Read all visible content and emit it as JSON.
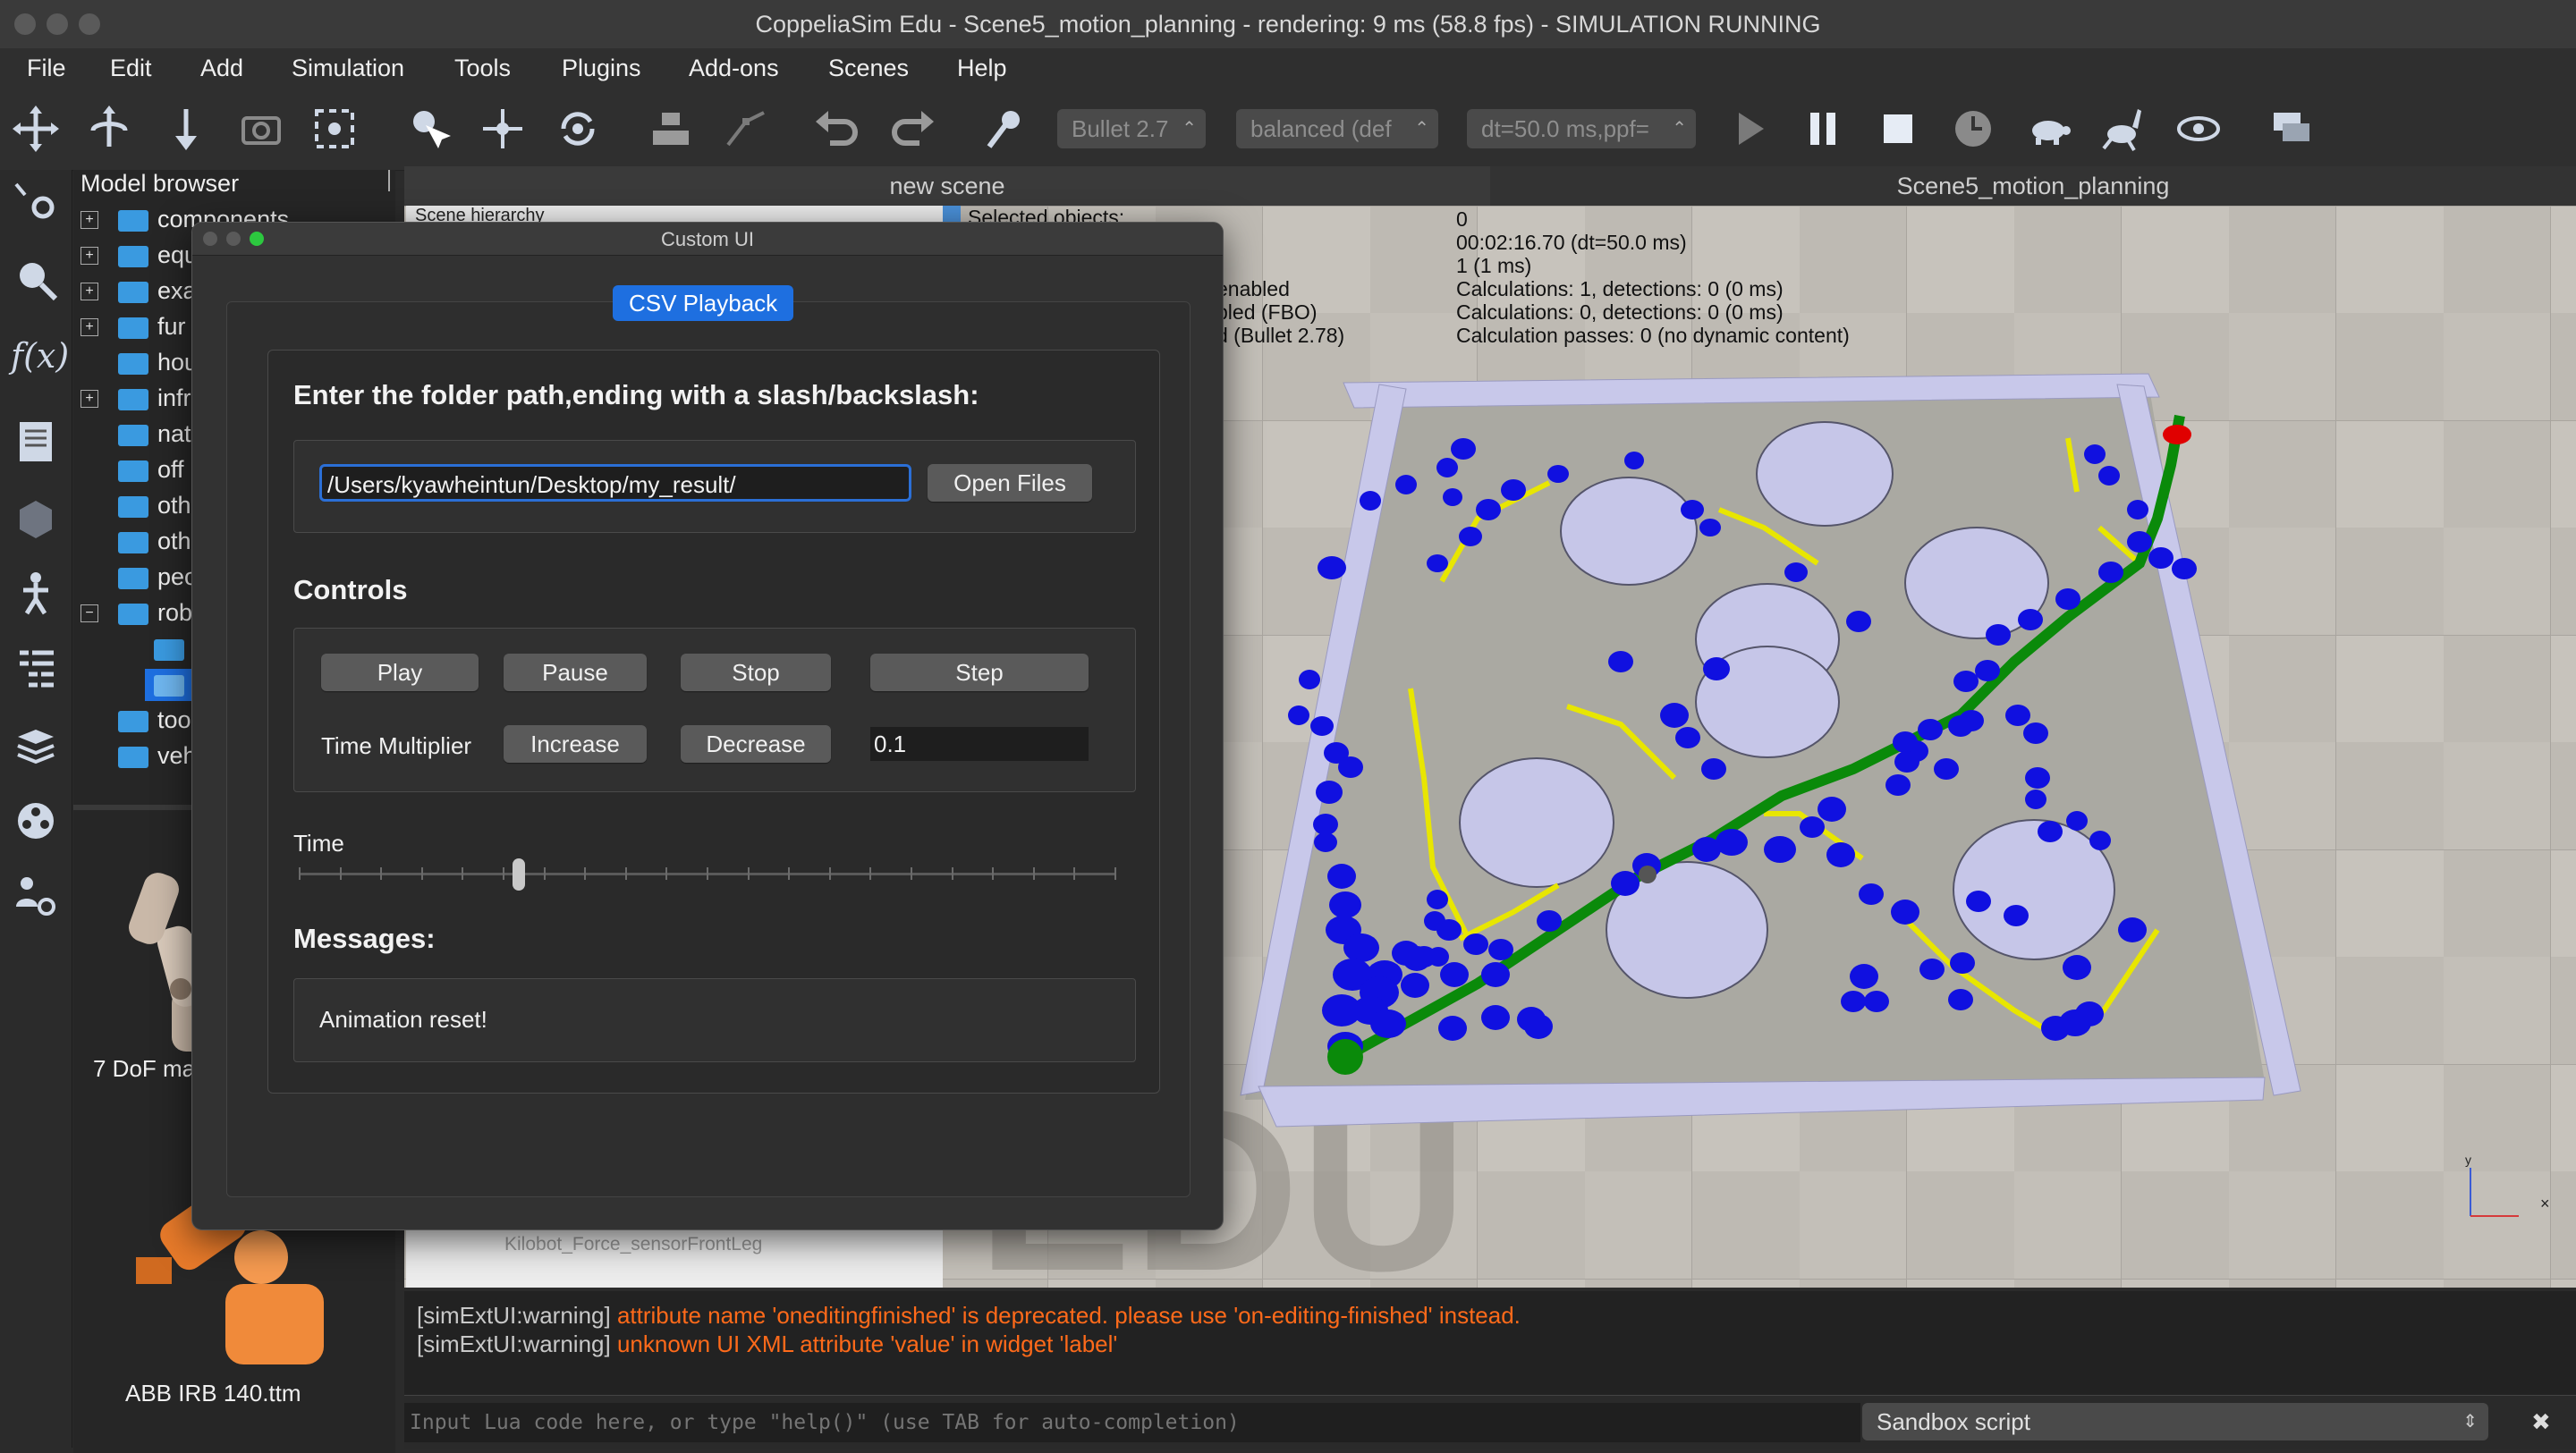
{
  "window": {
    "title": "CoppeliaSim Edu - Scene5_motion_planning - rendering: 9 ms (58.8 fps) - SIMULATION RUNNING"
  },
  "menu": [
    "File",
    "Edit",
    "Add",
    "Simulation",
    "Tools",
    "Plugins",
    "Add-ons",
    "Scenes",
    "Help"
  ],
  "toolbar": {
    "engine": "Bullet 2.7",
    "accuracy": "balanced (def",
    "timestep": "dt=50.0 ms,ppf="
  },
  "model_browser": {
    "title": "Model browser",
    "items": [
      "components",
      "equ",
      "exa",
      "fur",
      "hou",
      "infr",
      "nat",
      "off",
      "oth",
      "oth",
      "peo",
      "rob",
      "",
      "",
      "too",
      "veh"
    ],
    "thumb1_label": "7 DoF ma",
    "thumb2_label": "ABB IRB 140.ttm"
  },
  "tabs": [
    "new scene",
    "Scene5_motion_planning"
  ],
  "scene_info": {
    "hierarchy_label": "Scene hierarchy",
    "selected_label": "Selected objects:",
    "left_lines": [
      "enabled",
      "bled (FBO)",
      "d (Bullet 2.78)"
    ],
    "right_lines": [
      "0",
      "00:02:16.70 (dt=50.0 ms)",
      "1 (1 ms)",
      "Calculations: 1, detections: 0 (0 ms)",
      "Calculations: 0, detections: 0 (0 ms)",
      "Calculation passes: 0 (no dynamic content)"
    ],
    "hier_bottom": "Kilobot_Force_sensorFrontLeg",
    "watermark": "EDU"
  },
  "dialog": {
    "title": "Custom UI",
    "group_tab": "CSV Playback",
    "folder_heading": "Enter the folder path,ending with a slash/backslash:",
    "path_value": "/Users/kyawheintun/Desktop/my_result/",
    "open_files": "Open Files",
    "controls_heading": "Controls",
    "play": "Play",
    "pause": "Pause",
    "stop": "Stop",
    "step": "Step",
    "multiplier_label": "Time Multiplier",
    "increase": "Increase",
    "decrease": "Decrease",
    "multiplier_value": "0.1",
    "time_label": "Time",
    "time_fraction": 0.27,
    "messages_heading": "Messages:",
    "message": "Animation reset!"
  },
  "console": {
    "lines": [
      {
        "prefix": "[simExtUI:warning] ",
        "text": "attribute name 'oneditingfinished' is deprecated. please use 'on-editing-finished' instead."
      },
      {
        "prefix": "[simExtUI:warning] ",
        "text": "unknown UI XML attribute 'value' in widget 'label'"
      }
    ],
    "lua_placeholder": "Input Lua code here, or type \"help()\" (use TAB for auto-completion)",
    "script_selector": "Sandbox script",
    "close_label": "✖"
  },
  "colors": {
    "accent": "#1e6fe0",
    "warning": "#ff6a1a",
    "path_green": "#0a8a0a",
    "path_yellow": "#e8e600",
    "node_blue": "#1010e0",
    "goal_red": "#e00000",
    "obstacle": "#c6c6e8"
  }
}
